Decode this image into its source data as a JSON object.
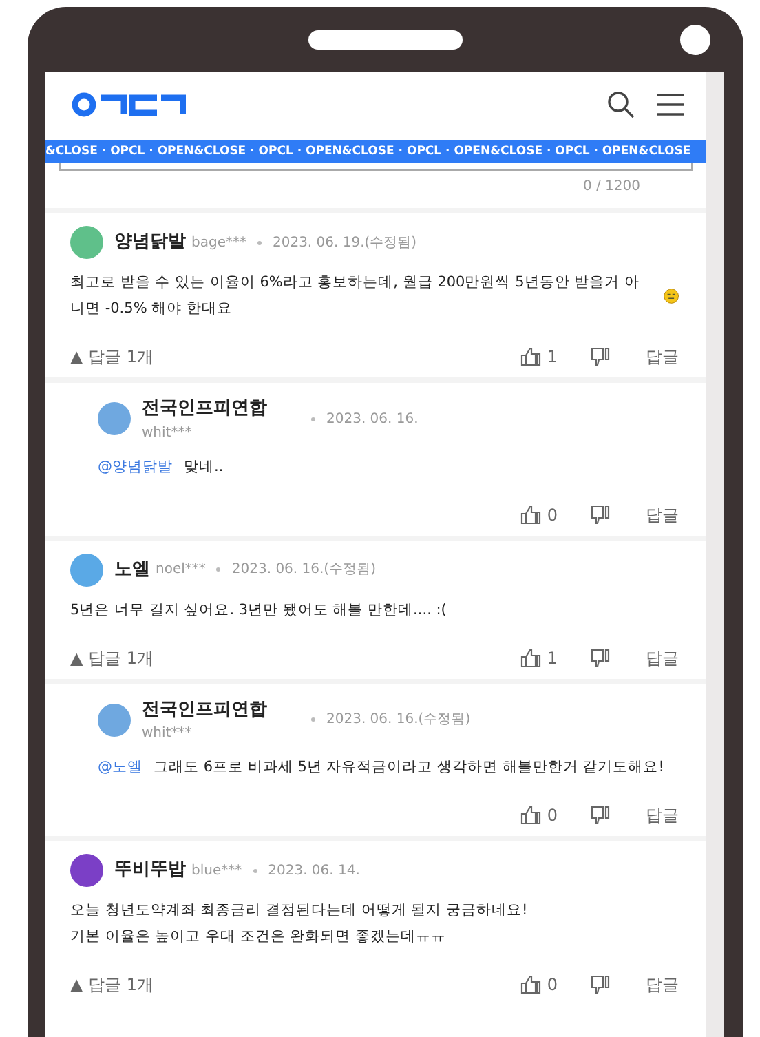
{
  "header": {
    "ticker": "&CLOSE · OPCL · OPEN&CLOSE · OPCL · OPEN&CLOSE · OPCL · OPEN&CLOSE · OPCL · OPEN&CLOSE"
  },
  "comment_form": {
    "counter": "0 / 1200"
  },
  "comments": [
    {
      "kind": "comment",
      "color": "#5fc08a",
      "name": "양념닭발",
      "user_id": "bage***",
      "date": "2023. 06. 19.(수정됨)",
      "body": "최고로 받을 수 있는 이율이 6%라고 홍보하는데, 월급 200만원씩 5년동안 받을거 아니면 -0.5% 해야 한대요",
      "emoji": true,
      "replies_toggle": "▲ 답글 1개",
      "likes": "1",
      "reply_label": "답글"
    },
    {
      "kind": "reply",
      "color": "#6fa8e0",
      "name": "전국인프피연합",
      "user_id": "whit***",
      "date": "2023. 06. 16.",
      "mention": "@양념닭발",
      "body": "맞네..",
      "emoji": false,
      "likes": "0",
      "reply_label": "답글"
    },
    {
      "kind": "comment",
      "color": "#5aa9e6",
      "name": "노엘",
      "user_id": "noel***",
      "date": "2023. 06. 16.(수정됨)",
      "body": "5년은 너무 길지 싶어요. 3년만 됐어도 해볼 만한데.... :(",
      "emoji": false,
      "replies_toggle": "▲ 답글 1개",
      "likes": "1",
      "reply_label": "답글"
    },
    {
      "kind": "reply",
      "color": "#6fa8e0",
      "name": "전국인프피연합",
      "user_id": "whit***",
      "date": "2023. 06. 16.(수정됨)",
      "mention": "@노엘",
      "body": "그래도 6프로 비과세 5년 자유적금이라고 생각하면 해볼만한거 같기도해요!",
      "emoji": false,
      "likes": "0",
      "reply_label": "답글"
    },
    {
      "kind": "comment",
      "color": "#7b3fc6",
      "name": "뚜비뚜밥",
      "user_id": "blue***",
      "date": "2023. 06. 14.",
      "body": "오늘 청년도약계좌 최종금리 결정된다는데 어떻게 될지 궁금하네요!\n기본 이율은 높이고 우대 조건은 완화되면 좋겠는데ㅠㅠ",
      "emoji": false,
      "replies_toggle": "▲ 답글 1개",
      "likes": "0",
      "reply_label": "답글"
    }
  ]
}
